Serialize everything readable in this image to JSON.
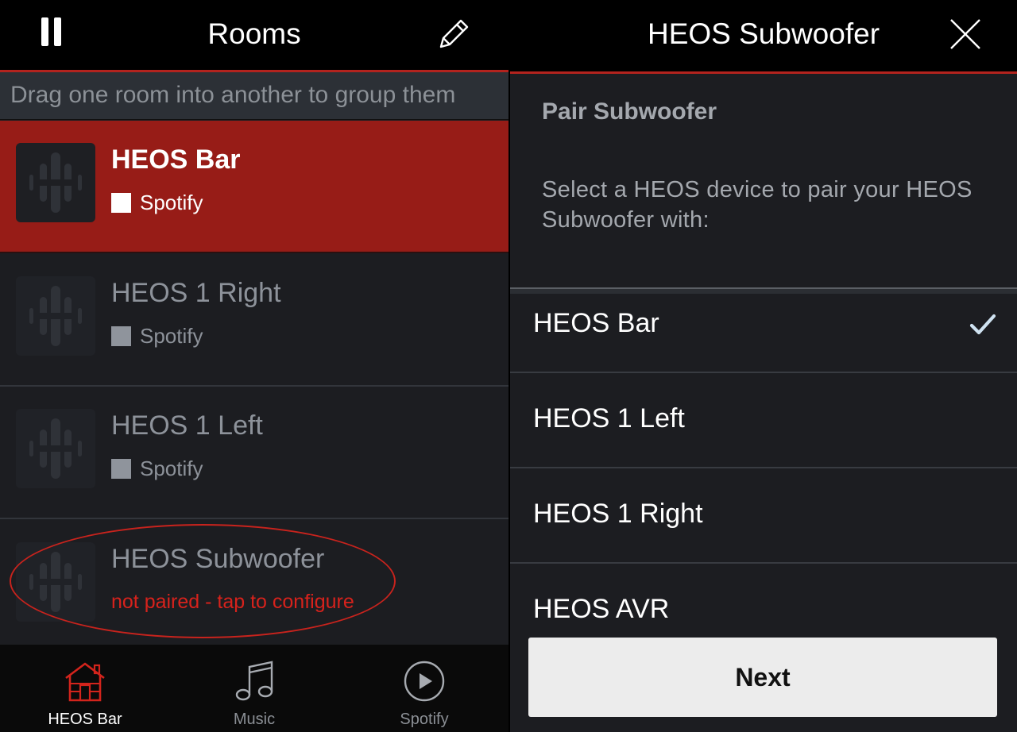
{
  "left": {
    "header": {
      "title": "Rooms",
      "pause_icon": "pause-icon",
      "edit_icon": "pencil-icon"
    },
    "hint": "Drag one room into another to group them",
    "rooms": [
      {
        "name": "HEOS Bar",
        "source": "Spotify",
        "state": "selected"
      },
      {
        "name": "HEOS 1 Right",
        "source": "Spotify",
        "state": "idle"
      },
      {
        "name": "HEOS 1 Left",
        "source": "Spotify",
        "state": "idle"
      },
      {
        "name": "HEOS Subwoofer",
        "status": "not paired - tap to configure",
        "state": "unpaired"
      }
    ],
    "tabs": [
      {
        "label": "HEOS Bar",
        "icon": "house-icon",
        "active": true
      },
      {
        "label": "Music",
        "icon": "music-note-icon",
        "active": false
      },
      {
        "label": "Spotify",
        "icon": "play-circle-icon",
        "active": false
      }
    ]
  },
  "right": {
    "header": {
      "title": "HEOS Subwoofer",
      "close_icon": "close-icon"
    },
    "section_title": "Pair Subwoofer",
    "description": "Select a HEOS device to pair your HEOS Subwoofer with:",
    "devices": [
      {
        "label": "HEOS Bar",
        "selected": true
      },
      {
        "label": "HEOS 1 Left",
        "selected": false
      },
      {
        "label": "HEOS 1 Right",
        "selected": false
      },
      {
        "label": "HEOS AVR",
        "selected": false
      }
    ],
    "next_label": "Next"
  },
  "colors": {
    "accent_red": "#b3231e",
    "selected_row": "#971c17",
    "background": "#1c1d21",
    "warning_text": "#d7221c"
  }
}
